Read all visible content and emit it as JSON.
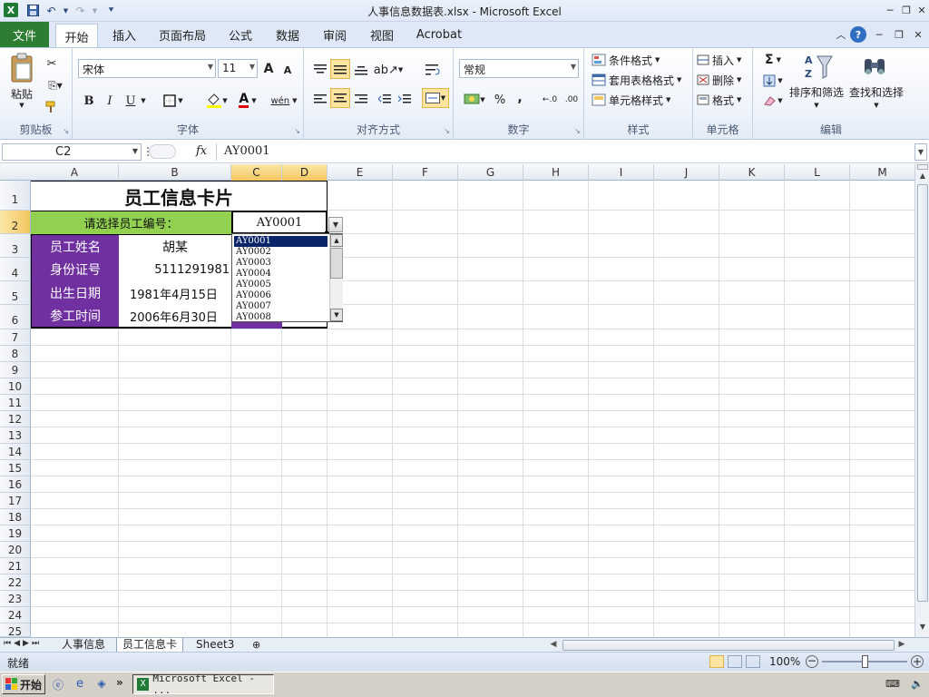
{
  "window": {
    "title": "人事信息数据表.xlsx - Microsoft Excel",
    "controls": [
      "─",
      "❐",
      "✕"
    ]
  },
  "ribbon_tabs": [
    "文件",
    "开始",
    "插入",
    "页面布局",
    "公式",
    "数据",
    "审阅",
    "视图",
    "Acrobat"
  ],
  "active_tab": "开始",
  "clipboard": {
    "paste_label": "粘贴",
    "group_name": "剪贴板"
  },
  "font": {
    "font_name": "宋体",
    "font_size": "11",
    "bold": "B",
    "italic": "I",
    "underline": "U",
    "grow": "A",
    "shrink": "A",
    "color_glyph": "A",
    "wen_glyph": "wén",
    "group_name": "字体"
  },
  "alignment": {
    "group_name": "对齐方式"
  },
  "number": {
    "format": "常规",
    "percent": "%",
    "comma": ",",
    "inc_decimal": "←.0",
    "dec_decimal": ".00",
    "group_name": "数字"
  },
  "styles": {
    "conditional": "条件格式",
    "table": "套用表格格式",
    "cell_styles": "单元格样式",
    "group_name": "样式"
  },
  "cells_group": {
    "insert": "插入",
    "delete": "删除",
    "format": "格式",
    "group_name": "单元格"
  },
  "editing": {
    "sigma": "Σ",
    "sort_filter": "排序和筛选",
    "find_select": "查找和选择",
    "group_name": "编辑"
  },
  "formula_bar": {
    "name_box": "C2",
    "fx": "fx",
    "content": "AY0001"
  },
  "columns": [
    "A",
    "B",
    "C",
    "D",
    "E",
    "F",
    "G",
    "H",
    "I",
    "J",
    "K",
    "L",
    "M"
  ],
  "rows": [
    "1",
    "2",
    "3",
    "4",
    "5",
    "6",
    "7",
    "8",
    "9",
    "10",
    "11",
    "12",
    "13",
    "14",
    "15",
    "16",
    "17",
    "18",
    "19",
    "20",
    "21",
    "22",
    "23",
    "24",
    "25"
  ],
  "card": {
    "title": "员工信息卡片",
    "select_prompt": "请选择员工编号：",
    "selected_id": "AY0001",
    "fields": [
      {
        "label": "员工姓名",
        "value": "胡某"
      },
      {
        "label": "身份证号",
        "value": "5111291981"
      },
      {
        "label": "出生日期",
        "value": "1981年4月15日"
      },
      {
        "label": "参工时间",
        "value": "2006年6月30日"
      }
    ]
  },
  "dropdown_items": [
    "AY0001",
    "AY0002",
    "AY0003",
    "AY0004",
    "AY0005",
    "AY0006",
    "AY0007",
    "AY0008"
  ],
  "sheet_tabs": [
    "人事信息",
    "员工信息卡",
    "Sheet3"
  ],
  "active_sheet": "员工信息卡",
  "status": {
    "mode": "就绪",
    "zoom": "100%"
  },
  "taskbar": {
    "start": "开始",
    "task": "Microsoft Excel - ..."
  },
  "colors": {
    "file_tab": "#2d7d33",
    "label_purple": "#7030a0",
    "prompt_green": "#92d050",
    "selected_header": "#f3c65f"
  }
}
